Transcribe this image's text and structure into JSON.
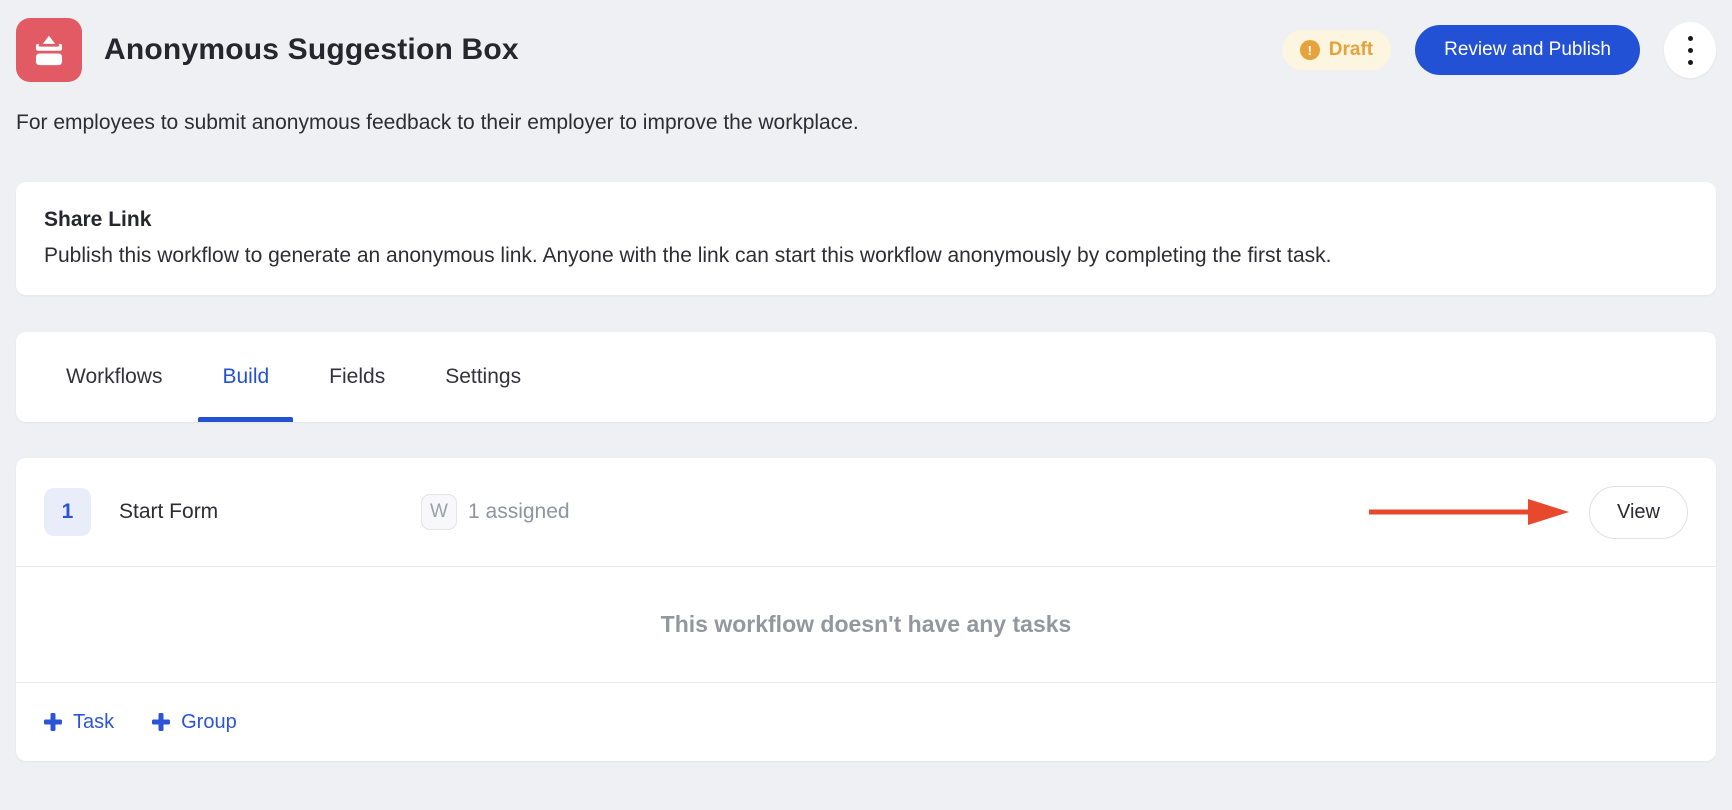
{
  "header": {
    "title": "Anonymous Suggestion Box",
    "status_badge": {
      "label": "Draft",
      "icon": "alert-circle-icon"
    },
    "publish_button_label": "Review and Publish",
    "menu_icon": "kebab-menu-icon",
    "app_icon": "ballot-box-icon"
  },
  "description": "For employees to submit anonymous feedback to their employer to improve the workplace.",
  "share_link": {
    "title": "Share Link",
    "body": "Publish this workflow to generate an anonymous link. Anyone with the link can start this workflow anonymously by completing the first task."
  },
  "tabs": [
    {
      "label": "Workflows",
      "active": false
    },
    {
      "label": "Build",
      "active": true
    },
    {
      "label": "Fields",
      "active": false
    },
    {
      "label": "Settings",
      "active": false
    }
  ],
  "task_row": {
    "number": "1",
    "title": "Start Form",
    "assignee_initial": "W",
    "assigned_text": "1 assigned",
    "view_button_label": "View",
    "annotation_icon": "red-arrow-annotation"
  },
  "empty_state_text": "This workflow doesn't have any tasks",
  "footer_actions": {
    "add_task_label": "Task",
    "add_group_label": "Group",
    "icon": "plus-icon"
  },
  "colors": {
    "page_background": "#eef0f3",
    "brand_red": "#e25a64",
    "accent_blue": "#2351d5",
    "status_orange": "#e6a23c",
    "status_badge_bg": "#fcf5df",
    "arrow_red": "#e8482c",
    "muted_gray": "#8e94a0"
  }
}
